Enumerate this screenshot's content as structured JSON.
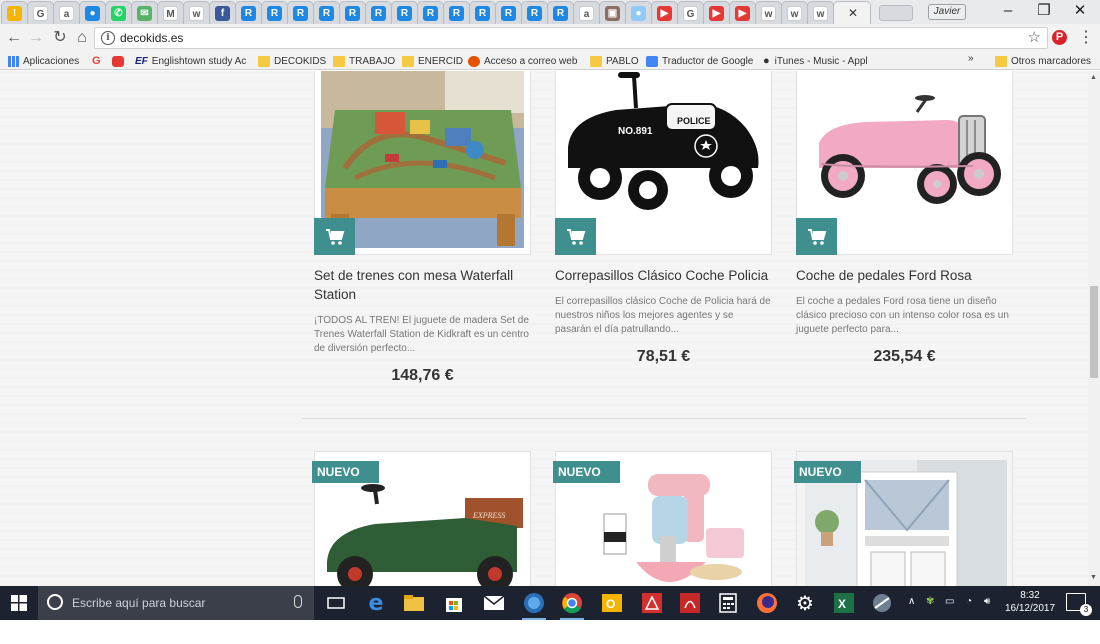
{
  "browser": {
    "tab_favicons": [
      {
        "icon": "warning-icon",
        "color": "#f4b400",
        "glyph": "!"
      },
      {
        "icon": "google-icon",
        "color": "#ffffff",
        "glyph": "G"
      },
      {
        "icon": "amazon-icon",
        "color": "#ffffff",
        "glyph": "a"
      },
      {
        "icon": "drop-icon",
        "color": "#1e88e5",
        "glyph": "●"
      },
      {
        "icon": "whatsapp-icon",
        "color": "#25d366",
        "glyph": "✆"
      },
      {
        "icon": "mail-icon",
        "color": "#58b368",
        "glyph": "✉"
      },
      {
        "icon": "gmail-icon",
        "color": "#ffffff",
        "glyph": "M"
      },
      {
        "icon": "site-w-icon",
        "color": "#ffffff",
        "glyph": "w"
      },
      {
        "icon": "facebook-icon",
        "color": "#3b5998",
        "glyph": "f"
      },
      {
        "icon": "site-r-icon",
        "color": "#1e88e5",
        "glyph": "R"
      },
      {
        "icon": "site-r-icon",
        "color": "#1e88e5",
        "glyph": "R"
      },
      {
        "icon": "site-r-icon",
        "color": "#1e88e5",
        "glyph": "R"
      },
      {
        "icon": "site-r-icon",
        "color": "#1e88e5",
        "glyph": "R"
      },
      {
        "icon": "site-r-icon",
        "color": "#1e88e5",
        "glyph": "R"
      },
      {
        "icon": "site-r-icon",
        "color": "#1e88e5",
        "glyph": "R"
      },
      {
        "icon": "site-r-icon",
        "color": "#1e88e5",
        "glyph": "R"
      },
      {
        "icon": "site-r-icon",
        "color": "#1e88e5",
        "glyph": "R"
      },
      {
        "icon": "site-r-icon",
        "color": "#1e88e5",
        "glyph": "R"
      },
      {
        "icon": "site-r-icon",
        "color": "#1e88e5",
        "glyph": "R"
      },
      {
        "icon": "site-r-icon",
        "color": "#1e88e5",
        "glyph": "R"
      },
      {
        "icon": "site-r-icon",
        "color": "#1e88e5",
        "glyph": "R"
      },
      {
        "icon": "site-r-icon",
        "color": "#1e88e5",
        "glyph": "R"
      },
      {
        "icon": "amazon-icon",
        "color": "#ffffff",
        "glyph": "a"
      },
      {
        "icon": "briefcase-icon",
        "color": "#8d6e63",
        "glyph": "▣"
      },
      {
        "icon": "globe-icon",
        "color": "#90caf9",
        "glyph": "●"
      },
      {
        "icon": "youtube-icon",
        "color": "#e53935",
        "glyph": "▶"
      },
      {
        "icon": "google-icon",
        "color": "#ffffff",
        "glyph": "G"
      },
      {
        "icon": "youtube-icon",
        "color": "#e53935",
        "glyph": "▶"
      },
      {
        "icon": "youtube-icon",
        "color": "#e53935",
        "glyph": "▶"
      },
      {
        "icon": "site-w-icon",
        "color": "#ffffff",
        "glyph": "w"
      },
      {
        "icon": "site-w-icon",
        "color": "#ffffff",
        "glyph": "w"
      },
      {
        "icon": "site-w-icon",
        "color": "#ffffff",
        "glyph": "w"
      }
    ],
    "user_name": "Javier",
    "url": "decokids.es",
    "bookmarks": [
      {
        "label": "Aplicaciones",
        "icon": "apps-icon"
      },
      {
        "label": "",
        "icon": "google-icon"
      },
      {
        "label": "",
        "icon": "youtube-icon"
      },
      {
        "label": "Englishtown study Ac",
        "icon": "ef-icon"
      },
      {
        "label": "DECOKIDS",
        "icon": "folder-icon"
      },
      {
        "label": "TRABAJO",
        "icon": "folder-icon"
      },
      {
        "label": "ENERCID",
        "icon": "folder-icon"
      },
      {
        "label": "Acceso a correo web",
        "icon": "mail-web-icon"
      },
      {
        "label": "PABLO",
        "icon": "folder-icon"
      },
      {
        "label": "Traductor de Google",
        "icon": "translate-icon"
      },
      {
        "label": "iTunes - Music - Appl",
        "icon": "apple-icon"
      }
    ],
    "bookmarks_overflow": "»",
    "other_bookmarks": "Otros marcadores"
  },
  "products_row1": [
    {
      "title": "Set de trenes con mesa Waterfall Station",
      "description": "¡TODOS AL TREN! El juguete de madera Set de Trenes Waterfall Station de Kidkraft es un centro de diversión perfecto...",
      "price": "148,76 €"
    },
    {
      "title": "Correpasillos Clásico Coche Policia",
      "description": "El correpasillos clásico Coche de Policia hará de nuestros niños los mejores agentes y se pasarán el día patrullando...",
      "price": "78,51 €",
      "plate": "NO.891",
      "decal": "POLICE"
    },
    {
      "title": "Coche de pedales Ford Rosa",
      "description": "El coche a pedales Ford rosa tiene un diseño clásico precioso con un intenso color rosa es un juguete perfecto para...",
      "price": "235,54 €"
    }
  ],
  "products_row2": [
    {
      "badge": "NUEVO",
      "truck_text": "EXPRESS"
    },
    {
      "badge": "NUEVO"
    },
    {
      "badge": "NUEVO"
    }
  ],
  "taskbar": {
    "search_placeholder": "Escribe aquí para buscar",
    "time": "8:32",
    "date": "16/12/2017",
    "notifications": "3"
  },
  "colors": {
    "accent": "#3f8f8f",
    "taskbar": "#1c2230"
  }
}
